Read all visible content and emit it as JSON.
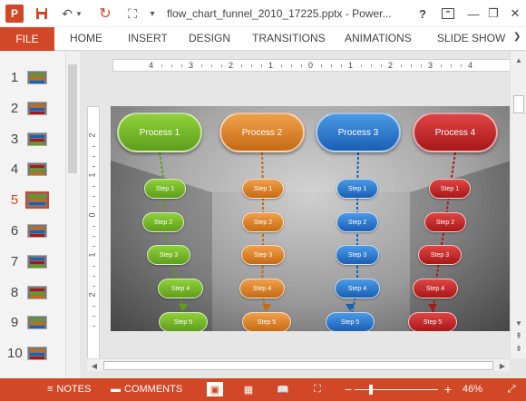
{
  "window": {
    "doc_title": "flow_chart_funnel_2010_17225.pptx - Power...",
    "help": "?",
    "minimize": "—",
    "restore": "❐",
    "close": "✕"
  },
  "quick_access": {
    "app_icon": "P",
    "save_icon": "💾",
    "undo_icon": "↶",
    "undo_dropdown": "▾",
    "redo_icon": "↻",
    "present_icon": "⛶",
    "customize_icon": "▾"
  },
  "ribbon": {
    "file": "FILE",
    "tabs": [
      "HOME",
      "INSERT",
      "DESIGN",
      "TRANSITIONS",
      "ANIMATIONS",
      "SLIDE SHOW"
    ],
    "more": "❯"
  },
  "thumbnails": {
    "items": [
      "1",
      "2",
      "3",
      "4",
      "5",
      "6",
      "7",
      "8",
      "9",
      "10"
    ],
    "active": "5"
  },
  "rulers": {
    "horizontal": [
      "4",
      "3",
      "2",
      "1",
      "0",
      "1",
      "2",
      "3",
      "4"
    ],
    "vertical": [
      "2",
      "1",
      "0",
      "1",
      "2"
    ]
  },
  "slide": {
    "columns": [
      {
        "process": "Process 1",
        "color": "#5e9e1c",
        "light": "#8fd13a",
        "steps": [
          "Step 1",
          "Step 2",
          "Step 3",
          "Step 4",
          "Step 5"
        ]
      },
      {
        "process": "Process 2",
        "color": "#c66a14",
        "light": "#f0a04a",
        "steps": [
          "Step 1",
          "Step 2",
          "Step 3",
          "Step 4",
          "Step 5"
        ]
      },
      {
        "process": "Process 3",
        "color": "#1a5fb4",
        "light": "#4a9ae6",
        "steps": [
          "Step 1",
          "Step 2",
          "Step 3",
          "Step 4",
          "Step 5"
        ]
      },
      {
        "process": "Process 4",
        "color": "#a81818",
        "light": "#e04444",
        "steps": [
          "Step 1",
          "Step 2",
          "Step 3",
          "Step 4",
          "Step 5"
        ]
      }
    ]
  },
  "statusbar": {
    "notes_icon": "≡",
    "notes": "NOTES",
    "comments_icon": "▬",
    "comments": "COMMENTS",
    "zoom_minus": "−",
    "zoom_plus": "+",
    "zoom_level": "46%",
    "zoom_value": 0.46
  }
}
